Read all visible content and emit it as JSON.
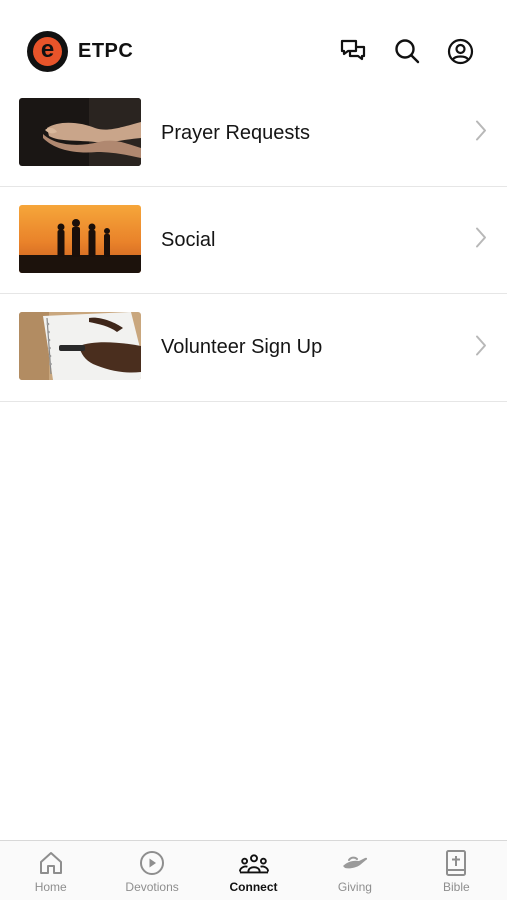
{
  "header": {
    "brand_name": "ETPC",
    "logo_letter": "e",
    "icons": [
      "chat-icon",
      "search-icon",
      "profile-icon"
    ]
  },
  "list": {
    "items": [
      {
        "label": "Prayer Requests",
        "image": "praying-hands"
      },
      {
        "label": "Social",
        "image": "sunset-silhouettes"
      },
      {
        "label": "Volunteer Sign Up",
        "image": "notebook-writing"
      }
    ]
  },
  "tabs": [
    {
      "label": "Home",
      "icon": "home-icon",
      "active": false
    },
    {
      "label": "Devotions",
      "icon": "play-circle-icon",
      "active": false
    },
    {
      "label": "Connect",
      "icon": "people-icon",
      "active": true
    },
    {
      "label": "Giving",
      "icon": "hand-icon",
      "active": false
    },
    {
      "label": "Bible",
      "icon": "bible-icon",
      "active": false
    }
  ],
  "colors": {
    "brand_orange": "#e8542a",
    "text_primary": "#111111",
    "tab_inactive": "#8e8e8e",
    "divider": "#e6e6e6"
  }
}
